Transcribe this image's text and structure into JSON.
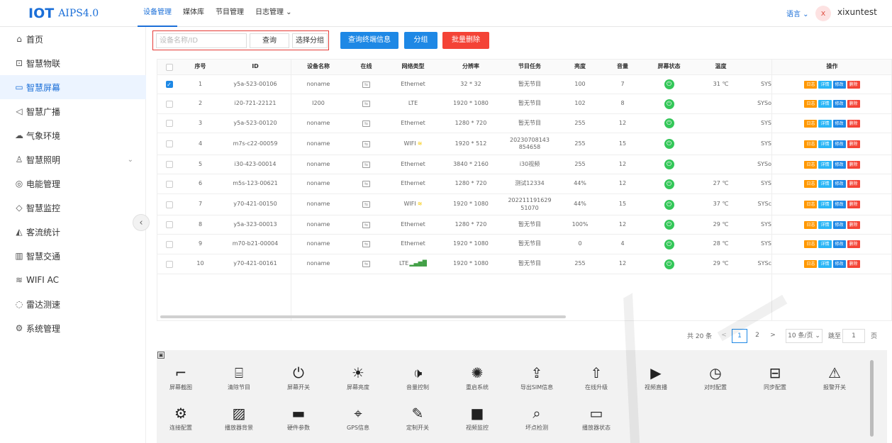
{
  "app": {
    "logo_mark": "IOT",
    "logo_version": "AIPS4.0"
  },
  "topnav": [
    "设备管理",
    "媒体库",
    "节目管理",
    "日志管理 ⌄"
  ],
  "header": {
    "language": "语言 ⌄",
    "avatar_letter": "x",
    "username": "xixuntest"
  },
  "sidebar": {
    "items": [
      {
        "label": "首页",
        "icon": "home-icon"
      },
      {
        "label": "智慧物联",
        "icon": "iot-icon"
      },
      {
        "label": "智慧屏幕",
        "icon": "screen-icon",
        "active": true
      },
      {
        "label": "智慧广播",
        "icon": "speaker-icon"
      },
      {
        "label": "气象环境",
        "icon": "weather-icon"
      },
      {
        "label": "智慧照明",
        "icon": "lighting-icon",
        "expandable": true
      },
      {
        "label": "电能管理",
        "icon": "power-icon"
      },
      {
        "label": "智慧监控",
        "icon": "monitor-icon"
      },
      {
        "label": "客流统计",
        "icon": "chart-icon"
      },
      {
        "label": "智慧交通",
        "icon": "traffic-icon"
      },
      {
        "label": "WIFI AC",
        "icon": "wifi-icon"
      },
      {
        "label": "雷达测速",
        "icon": "radar-icon"
      },
      {
        "label": "系统管理",
        "icon": "settings-icon"
      }
    ]
  },
  "toolbar": {
    "search_placeholder": "设备名称/ID",
    "query": "查询",
    "select_group": "选择分组",
    "query_terminal": "查询终端信息",
    "group": "分组",
    "batch_delete": "批量删除"
  },
  "table": {
    "columns": [
      "序号",
      "ID",
      "设备名称",
      "在线",
      "网络类型",
      "分辨率",
      "节目任务",
      "亮度",
      "音量",
      "屏幕状态",
      "温度",
      "",
      "操作"
    ],
    "actions": [
      "日志",
      "详情",
      "修改",
      "删除"
    ],
    "rows": [
      {
        "no": "1",
        "id": "y5a-523-00106",
        "name": "noname",
        "net": "Ethernet",
        "res": "32 * 32",
        "task": "暂无节目",
        "bright": "100",
        "vol": "7",
        "temp": "31 ℃",
        "sys": "SYS",
        "checked": true
      },
      {
        "no": "2",
        "id": "i20-721-22121",
        "name": "I200",
        "net": "LTE",
        "res": "1920 * 1080",
        "task": "暂无节目",
        "bright": "102",
        "vol": "8",
        "temp": "",
        "sys": "SYSo"
      },
      {
        "no": "3",
        "id": "y5a-523-00120",
        "name": "noname",
        "net": "Ethernet",
        "res": "1280 * 720",
        "task": "暂无节目",
        "bright": "255",
        "vol": "12",
        "temp": "",
        "sys": "SYS"
      },
      {
        "no": "4",
        "id": "m7s-c22-00059",
        "name": "noname",
        "net": "WIFI",
        "res": "1920 * 512",
        "task": "20230708143\n854658",
        "bright": "255",
        "vol": "15",
        "temp": "",
        "sys": "SYS"
      },
      {
        "no": "5",
        "id": "i30-423-00014",
        "name": "noname",
        "net": "Ethernet",
        "res": "3840 * 2160",
        "task": "i30视频",
        "bright": "255",
        "vol": "12",
        "temp": "",
        "sys": "SYSo"
      },
      {
        "no": "6",
        "id": "m5s-123-00621",
        "name": "noname",
        "net": "Ethernet",
        "res": "1280 * 720",
        "task": "测试12334",
        "bright": "44%",
        "vol": "12",
        "temp": "27 ℃",
        "sys": "SYS"
      },
      {
        "no": "7",
        "id": "y70-421-00150",
        "name": "noname",
        "net": "WIFI",
        "res": "1920 * 1080",
        "task": "202211191629\n51070",
        "bright": "44%",
        "vol": "15",
        "temp": "37 ℃",
        "sys": "SYSc"
      },
      {
        "no": "8",
        "id": "y5a-323-00013",
        "name": "noname",
        "net": "Ethernet",
        "res": "1280 * 720",
        "task": "暂无节目",
        "bright": "100%",
        "vol": "12",
        "temp": "29 ℃",
        "sys": "SYS"
      },
      {
        "no": "9",
        "id": "m70-b21-00004",
        "name": "noname",
        "net": "Ethernet",
        "res": "1920 * 1080",
        "task": "暂无节目",
        "bright": "0",
        "vol": "4",
        "temp": "28 ℃",
        "sys": "SYS"
      },
      {
        "no": "10",
        "id": "y70-421-00161",
        "name": "noname",
        "net": "LTE",
        "res": "1920 * 1080",
        "task": "暂无节目",
        "bright": "255",
        "vol": "12",
        "temp": "29 ℃",
        "sys": "SYSc"
      }
    ]
  },
  "pagination": {
    "total": "共 20 条",
    "prev": "<",
    "page1": "1",
    "page2": "2",
    "next": ">",
    "page_size": "10 条/页 ⌄",
    "goto_label": "跳至",
    "goto_value": "1",
    "page_suffix": "页"
  },
  "panel": {
    "toggle": "▣",
    "tools": [
      {
        "label": "屏幕截图",
        "glyph": "⌐"
      },
      {
        "label": "清除节目",
        "glyph": "⌸"
      },
      {
        "label": "屏幕开关",
        "glyph": "⏻"
      },
      {
        "label": "屏幕亮度",
        "glyph": "☀"
      },
      {
        "label": "音量控制",
        "glyph": "🕩"
      },
      {
        "label": "重启系统",
        "glyph": "✺"
      },
      {
        "label": "导出SIM信息",
        "glyph": "⇪"
      },
      {
        "label": "在线升级",
        "glyph": "⇧"
      },
      {
        "label": "视频直播",
        "glyph": "▶"
      },
      {
        "label": "对时配置",
        "glyph": "◷"
      },
      {
        "label": "同步配置",
        "glyph": "⊟"
      },
      {
        "label": "报警开关",
        "glyph": "⚠"
      },
      {
        "label": "连接配置",
        "glyph": "⚙"
      },
      {
        "label": "播放器背景",
        "glyph": "▨"
      },
      {
        "label": "硬件参数",
        "glyph": "▬"
      },
      {
        "label": "GPS信息",
        "glyph": "⌖"
      },
      {
        "label": "定制开关",
        "glyph": "✎"
      },
      {
        "label": "视频监控",
        "glyph": "■"
      },
      {
        "label": "坏点检测",
        "glyph": "⌕"
      },
      {
        "label": "播放器状态",
        "glyph": "▭"
      }
    ]
  },
  "colors": {
    "primary": "#1e88e5",
    "danger": "#f44336",
    "warning": "#ff9800",
    "info": "#29b6f6",
    "success": "#34c759",
    "sidebar_active_bg": "#ecf4ff"
  }
}
